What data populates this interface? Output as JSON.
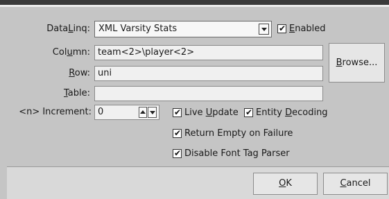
{
  "form": {
    "dataling_label": {
      "pre": "Data",
      "key": "L",
      "post": "inq:"
    },
    "dataling_value": "XML Varsity Stats",
    "enabled": {
      "pre": "",
      "key": "E",
      "post": "nabled",
      "checked": true
    },
    "column_label": {
      "pre": "Col",
      "key": "u",
      "post": "mn:"
    },
    "column_value": "team<2>\\player<2>",
    "row_label": {
      "pre": "",
      "key": "R",
      "post": "ow:"
    },
    "row_value": "uni",
    "table_label": {
      "pre": "",
      "key": "T",
      "post": "able:"
    },
    "table_value": "",
    "increment_label": "<n> Increment:",
    "increment_value": "0",
    "browse_label": {
      "pre": "",
      "key": "B",
      "post": "rowse..."
    },
    "live_update": {
      "pre": "Live ",
      "key": "U",
      "post": "pdate",
      "checked": true
    },
    "entity_decoding": {
      "pre": "Entity ",
      "key": "D",
      "post": "ecoding",
      "checked": true
    },
    "return_empty": {
      "pre": "Return Empty on Failure",
      "key": "",
      "post": "",
      "checked": true
    },
    "disable_font": {
      "pre": "Disable Font Tag Parser",
      "key": "",
      "post": "",
      "checked": true
    }
  },
  "footer": {
    "ok_label": {
      "pre": "",
      "key": "O",
      "post": "K"
    },
    "cancel_label": {
      "pre": "",
      "key": "C",
      "post": "ancel"
    }
  },
  "icons": {
    "dropdown": "chevron-down-icon",
    "checkmark": "✔",
    "spin_up": "triangle-up-icon",
    "spin_down": "triangle-down-icon"
  },
  "colors": {
    "panel": "#c5c5c5",
    "footer": "#d9d9d9",
    "field_bg": "#f0f0f0"
  }
}
